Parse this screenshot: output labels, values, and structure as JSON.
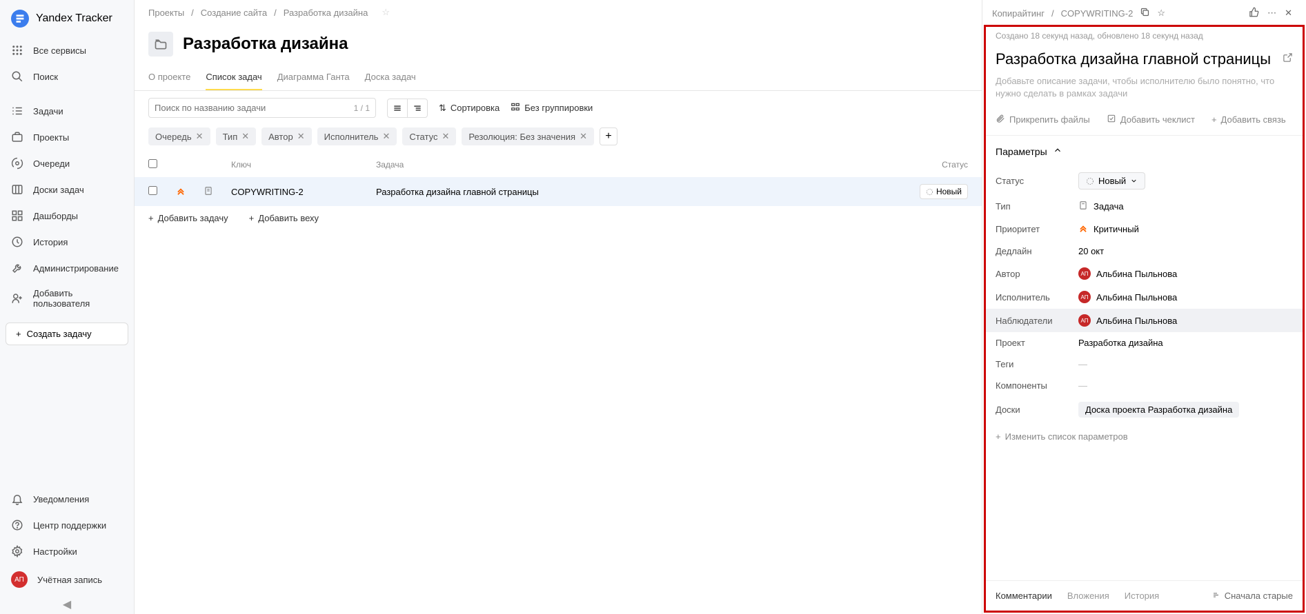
{
  "sidebar": {
    "brand": "Yandex Tracker",
    "items": [
      "Все сервисы",
      "Поиск",
      "Задачи",
      "Проекты",
      "Очереди",
      "Доски задач",
      "Дашборды",
      "История",
      "Администрирование",
      "Добавить пользователя"
    ],
    "create_task": "Создать задачу",
    "bottom": [
      "Уведомления",
      "Центр поддержки",
      "Настройки",
      "Учётная запись"
    ],
    "user_badge": "АП"
  },
  "breadcrumb": {
    "l1": "Проекты",
    "l2": "Создание сайта",
    "l3": "Разработка дизайна"
  },
  "page_title": "Разработка дизайна",
  "tabs": [
    "О проекте",
    "Список задач",
    "Диаграмма Ганта",
    "Доска задач"
  ],
  "search": {
    "placeholder": "Поиск по названию задачи",
    "count": "1 / 1"
  },
  "toolbar": {
    "sort": "Сортировка",
    "group": "Без группировки"
  },
  "filters": [
    "Очередь",
    "Тип",
    "Автор",
    "Исполнитель",
    "Статус",
    "Резолюция: Без значения"
  ],
  "table": {
    "head": {
      "key": "Ключ",
      "task": "Задача",
      "status": "Статус"
    },
    "row": {
      "key": "COPYWRITING-2",
      "task": "Разработка дизайна главной страницы",
      "status": "Новый"
    },
    "add_task": "Добавить задачу",
    "add_milestone": "Добавить веху"
  },
  "panel": {
    "bc1": "Копирайтинг",
    "bc2": "COPYWRITING-2",
    "meta": "Создано 18 секунд назад, обновлено 18 секунд назад",
    "title": "Разработка дизайна главной страницы",
    "description": "Добавьте описание задачи, чтобы исполнителю было понятно, что нужно сделать в рамках задачи",
    "actions": {
      "attach": "Прикрепить файлы",
      "checklist": "Добавить чеклист",
      "link": "Добавить связь"
    },
    "params_title": "Параметры",
    "params": {
      "status_label": "Статус",
      "status": "Новый",
      "type_label": "Тип",
      "type": "Задача",
      "priority_label": "Приоритет",
      "priority": "Критичный",
      "deadline_label": "Дедлайн",
      "deadline": "20 окт",
      "author_label": "Автор",
      "author": "Альбина Пыльнова",
      "assignee_label": "Исполнитель",
      "assignee": "Альбина Пыльнова",
      "watchers_label": "Наблюдатели",
      "watchers": "Альбина Пыльнова",
      "project_label": "Проект",
      "project": "Разработка дизайна",
      "tags_label": "Теги",
      "tags": "—",
      "components_label": "Компоненты",
      "components": "—",
      "boards_label": "Доски",
      "boards": "Доска проекта Разработка дизайна"
    },
    "change_params": "Изменить список параметров",
    "tabs": {
      "comments": "Комментарии",
      "attachments": "Вложения",
      "history": "История",
      "sort": "Сначала старые"
    }
  }
}
